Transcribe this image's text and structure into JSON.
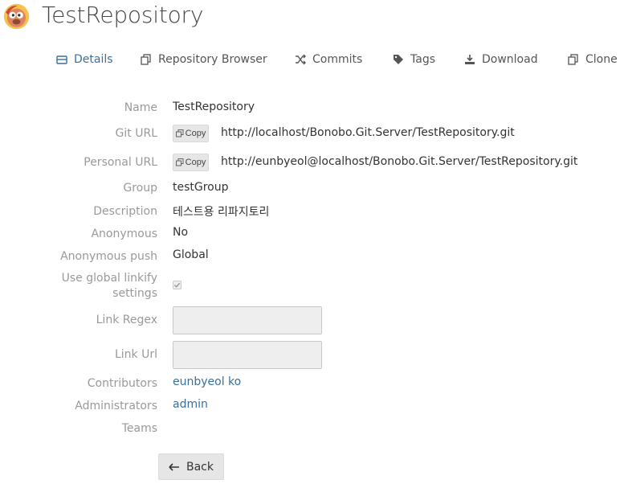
{
  "header": {
    "title": "TestRepository",
    "logo_icon": "bonobo-logo-icon"
  },
  "tabs": [
    {
      "label": "Details",
      "icon": "list-icon",
      "active": true
    },
    {
      "label": "Repository Browser",
      "icon": "copy-icon",
      "active": false
    },
    {
      "label": "Commits",
      "icon": "shuffle-icon",
      "active": false
    },
    {
      "label": "Tags",
      "icon": "tag-icon",
      "active": false
    },
    {
      "label": "Download",
      "icon": "download-icon",
      "active": false
    },
    {
      "label": "Clone",
      "icon": "copy-icon",
      "active": false
    }
  ],
  "details": {
    "name_label": "Name",
    "name_value": "TestRepository",
    "git_url_label": "Git URL",
    "git_url_value": "http://localhost/Bonobo.Git.Server/TestRepository.git",
    "personal_url_label": "Personal URL",
    "personal_url_value": "http://eunbyeol@localhost/Bonobo.Git.Server/TestRepository.git",
    "copy_label": "Copy",
    "group_label": "Group",
    "group_value": "testGroup",
    "description_label": "Description",
    "description_value": "테스트용 리파지토리",
    "anonymous_label": "Anonymous",
    "anonymous_value": "No",
    "anonymous_push_label": "Anonymous push",
    "anonymous_push_value": "Global",
    "use_global_linkify_label": "Use global linkify settings",
    "use_global_linkify_checked": true,
    "link_regex_label": "Link Regex",
    "link_regex_value": "",
    "link_url_label": "Link Url",
    "link_url_value": "",
    "contributors_label": "Contributors",
    "contributors": [
      "eunbyeol ko"
    ],
    "administrators_label": "Administrators",
    "administrators": [
      "admin"
    ],
    "teams_label": "Teams",
    "teams": []
  },
  "footer": {
    "back_label": "Back"
  },
  "colors": {
    "link": "#3a6f9e",
    "label": "#999999",
    "button_bg": "#e6e6e6"
  }
}
